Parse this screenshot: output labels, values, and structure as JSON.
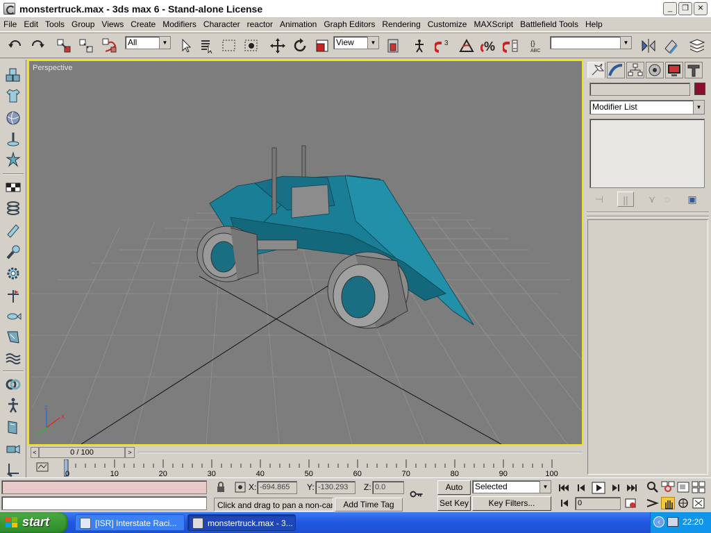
{
  "window": {
    "title": "monstertruck.max - 3ds max 6 - Stand-alone License",
    "controls": {
      "minimize": "_",
      "maximize": "❐",
      "close": "✕"
    }
  },
  "menu": [
    "File",
    "Edit",
    "Tools",
    "Group",
    "Views",
    "Create",
    "Modifiers",
    "Character",
    "reactor",
    "Animation",
    "Graph Editors",
    "Rendering",
    "Customize",
    "MAXScript",
    "Battlefield Tools",
    "Help"
  ],
  "toolbar": {
    "selection_filter": "All",
    "reference_coord": "View",
    "snap_label": "3",
    "named_selection": ""
  },
  "viewport": {
    "label": "Perspective",
    "background": "#7d7d7d",
    "active_border": "#f3e312",
    "model_color": "#1a7f96",
    "axis_labels": {
      "x": "x",
      "y": "y",
      "z": "z"
    }
  },
  "timeslider": {
    "frame_label": "0 / 100",
    "prev": "<",
    "next": ">"
  },
  "trackbar": {
    "ticks": [
      "0",
      "10",
      "20",
      "30",
      "40",
      "50",
      "60",
      "70",
      "80",
      "90",
      "100"
    ]
  },
  "command_panel": {
    "object_name": "",
    "object_color": "#8a0f2e",
    "modifier_list": "Modifier List",
    "tabs": [
      "create-tab",
      "modify-tab",
      "hierarchy-tab",
      "motion-tab",
      "display-tab",
      "utilities-tab"
    ]
  },
  "status": {
    "x_label": "X:",
    "x_value": "-694.865",
    "y_label": "Y:",
    "y_value": "-130.293",
    "z_label": "Z:",
    "z_value": "0.0",
    "prompt": "Click and drag to pan a non-camera view",
    "add_time_tag": "Add Time Tag",
    "auto_key": "Auto Key",
    "set_key": "Set Key",
    "key_mode": "Selected",
    "key_filters": "Key Filters...",
    "current_frame": "0"
  },
  "taskbar": {
    "start": "start",
    "tasks": [
      "[ISR] Interstate Raci...",
      "monstertruck.max - 3..."
    ],
    "clock": "22:20"
  }
}
